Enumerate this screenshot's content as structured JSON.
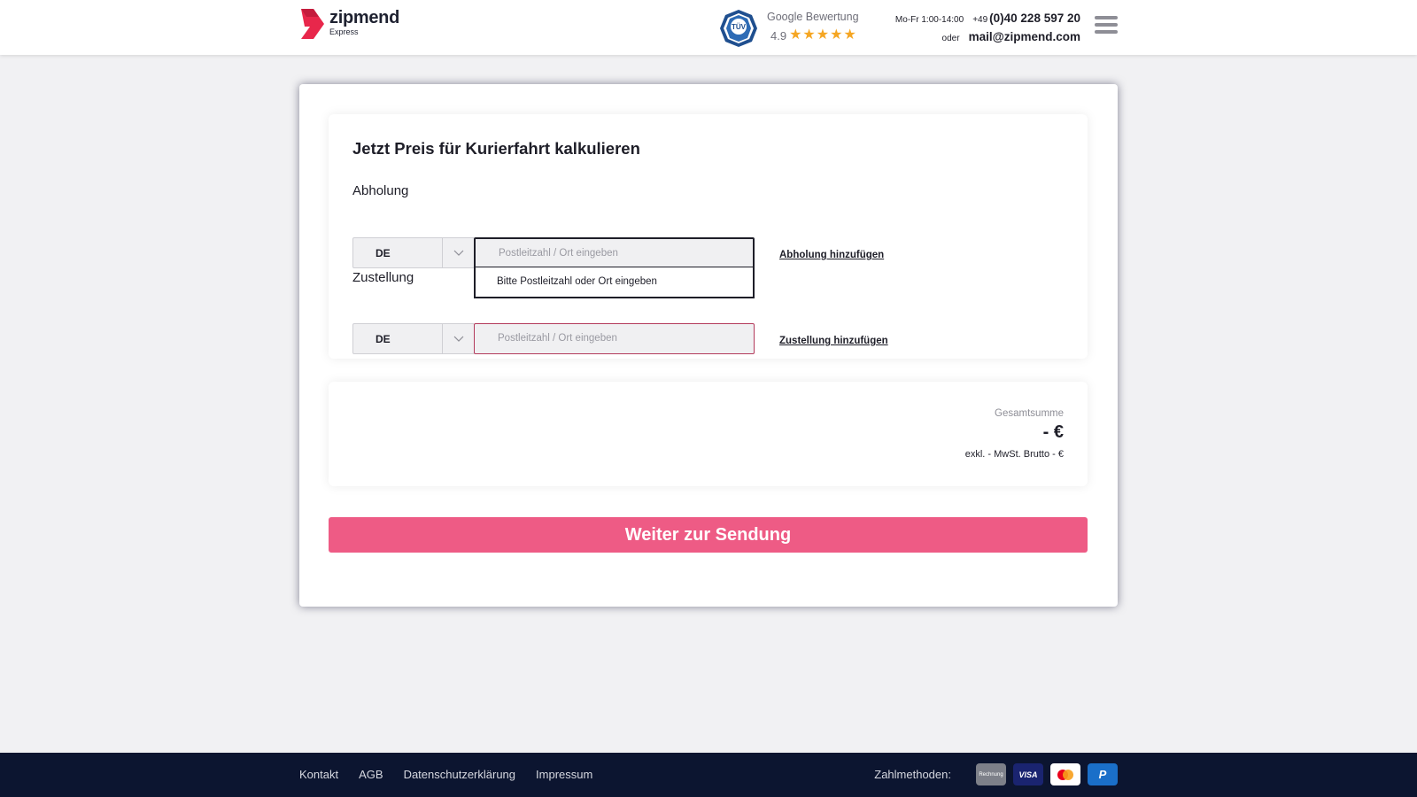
{
  "header": {
    "logo_name": "zipmend",
    "logo_sub": "Express",
    "tuv_text": "TÜV",
    "rating_label": "Google Bewertung",
    "rating_score": "4.9",
    "rating_stars": 5,
    "hours": "Mo-Fr 1:00-14:00",
    "phone_prefix": "+49",
    "phone": "(0)40 228 597 20",
    "oder": "oder",
    "email": "mail@zipmend.com",
    "menu_icon": "hamburger-menu-icon"
  },
  "form": {
    "title": "Jetzt Preis für Kurierfahrt kalkulieren",
    "pickup": {
      "label": "Abholung",
      "country": "DE",
      "zip_placeholder": "Postleitzahl / Ort eingeben",
      "dropdown_hint": "Bitte Postleitzahl oder Ort eingeben",
      "add_link": "Abholung hinzufügen"
    },
    "delivery": {
      "label": "Zustellung",
      "country": "DE",
      "zip_placeholder": "Postleitzahl / Ort eingeben",
      "add_link": "Zustellung hinzufügen"
    }
  },
  "summary": {
    "total_label": "Gesamtsumme",
    "total_value": "- €",
    "total_sub": "exkl. - MwSt. Brutto - €"
  },
  "cta": {
    "label": "Weiter zur Sendung"
  },
  "footer": {
    "links": [
      "Kontakt",
      "AGB",
      "Datenschutzerklärung",
      "Impressum"
    ],
    "payment_label": "Zahlmethoden:",
    "payments": {
      "invoice": "Rechnung",
      "visa": "VISA"
    }
  },
  "colors": {
    "brand_pink": "#ee5b85",
    "logo_red": "#e8274b",
    "footer_navy": "#0c1530",
    "star_gold": "#f5a623"
  }
}
